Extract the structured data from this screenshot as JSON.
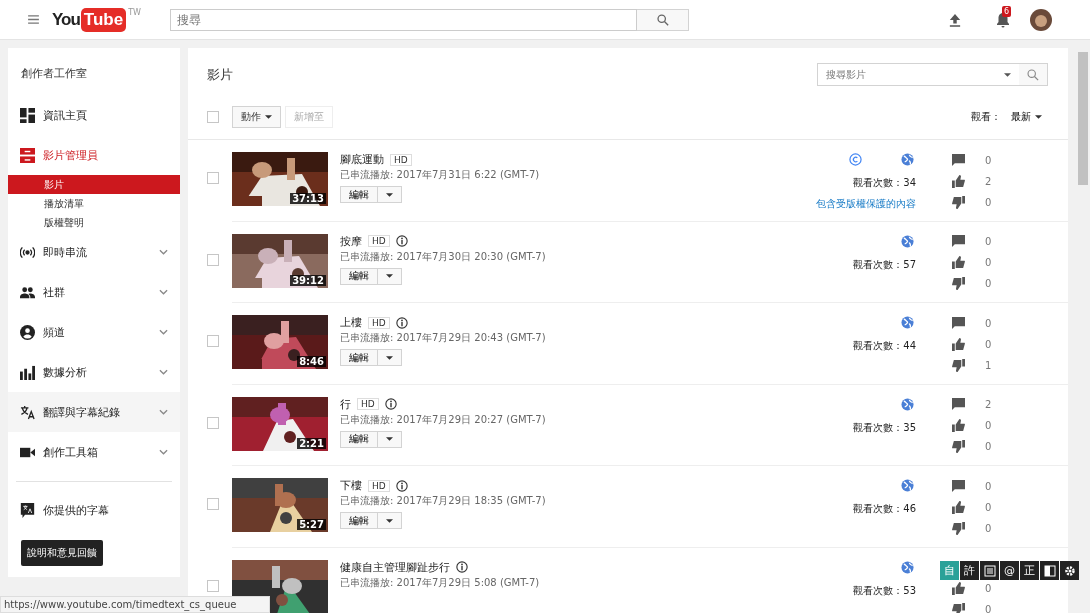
{
  "topbar": {
    "logo_you": "You",
    "logo_tube": "Tube",
    "logo_region": "TW",
    "search": {
      "placeholder": "搜尋"
    },
    "notifications": "6"
  },
  "sidebar": {
    "title": "創作者工作室",
    "items": [
      {
        "label": "資訊主頁",
        "selected": false,
        "expandable": false
      },
      {
        "label": "影片管理員",
        "selected": true,
        "expandable": false,
        "children": [
          {
            "label": "影片",
            "selected": true
          },
          {
            "label": "播放清單",
            "selected": false
          },
          {
            "label": "版權聲明",
            "selected": false
          }
        ]
      },
      {
        "label": "即時串流",
        "selected": false,
        "expandable": true
      },
      {
        "label": "社群",
        "selected": false,
        "expandable": true
      },
      {
        "label": "頻道",
        "selected": false,
        "expandable": true
      },
      {
        "label": "數據分析",
        "selected": false,
        "expandable": true
      },
      {
        "label": "翻譯與字幕紀錄",
        "selected": false,
        "expandable": true
      },
      {
        "label": "創作工具箱",
        "selected": false,
        "expandable": true
      }
    ],
    "subtitles_link": "你提供的字幕",
    "feedback_button": "說明和意見回饋"
  },
  "main": {
    "title": "影片",
    "search": {
      "placeholder": "搜尋影片"
    },
    "select_all": {
      "checked": false
    },
    "actions_button": "動作",
    "add_to_button": {
      "label": "新增至",
      "disabled": true
    },
    "sort_label": "觀看：",
    "sort_value": "最新",
    "videos": [
      {
        "title": "腳底運動",
        "hd": "HD",
        "info": false,
        "copyright": true,
        "published": "已串流播放: 2017年7月31日 6:22 (GMT-7)",
        "duration": "37:13",
        "edit": "編輯",
        "views": "觀看次數：34",
        "copyright_notice": "包含受版權保護的內容",
        "comments": "0",
        "likes": "2",
        "dislikes": "0",
        "checked": false
      },
      {
        "title": "按摩",
        "hd": "HD",
        "info": true,
        "copyright": false,
        "published": "已串流播放: 2017年7月30日 20:30 (GMT-7)",
        "duration": "39:12",
        "edit": "編輯",
        "views": "觀看次數：57",
        "comments": "0",
        "likes": "0",
        "dislikes": "0",
        "checked": false
      },
      {
        "title": "上樓",
        "hd": "HD",
        "info": true,
        "copyright": false,
        "published": "已串流播放: 2017年7月29日 20:43 (GMT-7)",
        "duration": "8:46",
        "edit": "編輯",
        "views": "觀看次數：44",
        "comments": "0",
        "likes": "0",
        "dislikes": "1",
        "checked": false
      },
      {
        "title": "行",
        "hd": "HD",
        "info": true,
        "copyright": false,
        "published": "已串流播放: 2017年7月29日 20:27 (GMT-7)",
        "duration": "2:21",
        "edit": "編輯",
        "views": "觀看次數：35",
        "comments": "2",
        "likes": "0",
        "dislikes": "0",
        "checked": false
      },
      {
        "title": "下樓",
        "hd": "HD",
        "info": true,
        "copyright": false,
        "published": "已串流播放: 2017年7月29日 18:35 (GMT-7)",
        "duration": "5:27",
        "edit": "編輯",
        "views": "觀看次數：46",
        "comments": "0",
        "likes": "0",
        "dislikes": "0",
        "checked": false
      },
      {
        "title": "健康自主管理腳趾步行",
        "info": true,
        "copyright": false,
        "published": "已串流播放: 2017年7月29日 5:08 (GMT-7)",
        "views": "觀看次數：53",
        "likes": "0",
        "dislikes": "0",
        "checked": false
      }
    ]
  },
  "status_bar": "https://www.youtube.com/timedtext_cs_queue",
  "ime_toolbar": [
    {
      "kind": "char",
      "label": "自",
      "selected": true
    },
    {
      "kind": "char",
      "label": "許",
      "selected": false
    },
    {
      "kind": "doc",
      "selected": false
    },
    {
      "kind": "char",
      "label": "@",
      "selected": false
    },
    {
      "kind": "char",
      "label": "正",
      "selected": false
    },
    {
      "kind": "halfmoon",
      "selected": false
    },
    {
      "kind": "gear",
      "selected": false
    }
  ]
}
